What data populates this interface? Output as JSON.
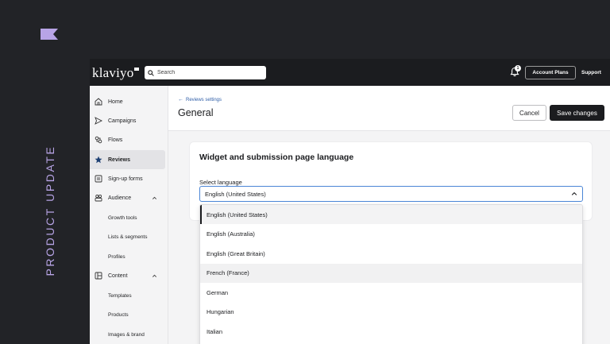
{
  "promo": {
    "caption": "PRODUCT UPDATE",
    "flag_icon": "flag-icon",
    "accent_color": "#b8a4e6"
  },
  "topbar": {
    "logo": "klaviyo",
    "search_placeholder": "Search",
    "notification_count": "1",
    "account_button": "Account Plans",
    "support_link": "Support"
  },
  "sidebar": {
    "items": [
      {
        "label": "Home",
        "icon": "home-icon"
      },
      {
        "label": "Campaigns",
        "icon": "send-icon"
      },
      {
        "label": "Flows",
        "icon": "flows-icon"
      },
      {
        "label": "Reviews",
        "icon": "star-icon"
      },
      {
        "label": "Sign-up forms",
        "icon": "form-icon"
      },
      {
        "label": "Audience",
        "icon": "audience-icon"
      },
      {
        "label": "Growth tools"
      },
      {
        "label": "Lists & segments"
      },
      {
        "label": "Profiles"
      },
      {
        "label": "Content",
        "icon": "content-icon"
      },
      {
        "label": "Templates"
      },
      {
        "label": "Products"
      },
      {
        "label": "Images & brand"
      }
    ]
  },
  "header": {
    "back_link": "Reviews settings",
    "title": "General",
    "cancel": "Cancel",
    "save": "Save changes"
  },
  "card": {
    "title": "Widget and submission page language",
    "field_label": "Select language",
    "selected": "English (United States)"
  },
  "dropdown": {
    "options": [
      "English (United States)",
      "English (Australia)",
      "English (Great Britain)",
      "French (France)",
      "German",
      "Hungarian",
      "Italian"
    ]
  }
}
